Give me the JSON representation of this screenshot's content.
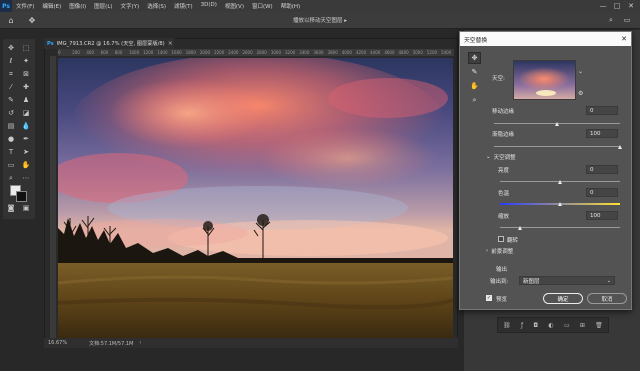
{
  "app": {
    "logo": "Ps"
  },
  "menu": {
    "items": [
      "文件(F)",
      "编辑(E)",
      "图像(I)",
      "图层(L)",
      "文字(Y)",
      "选择(S)",
      "滤镜(T)",
      "3D(D)",
      "视图(V)",
      "窗口(W)",
      "帮助(H)"
    ],
    "window_controls": [
      "—",
      "□",
      "✕"
    ]
  },
  "options_bar": {
    "center_title": "播放以移动天空图层 ▸"
  },
  "document": {
    "tab_title": "IMG_7913.CR2 @ 16.7% (天空, 图层蒙版/8)",
    "tab_close": "×",
    "ruler_ticks": [
      "0",
      "200",
      "400",
      "600",
      "800",
      "1000",
      "1200",
      "1400",
      "1600",
      "1800",
      "2000",
      "2200",
      "2400",
      "2600",
      "2800",
      "3000",
      "3200",
      "3400",
      "3600",
      "3800",
      "4000",
      "4200",
      "4400",
      "4600",
      "4800",
      "5000",
      "5200",
      "5400"
    ],
    "zoom": "16.67%",
    "doc_info": "文档:57.1M/57.1M",
    "status_arrow": "›"
  },
  "dialog": {
    "title": "天空替换",
    "close": "✕",
    "sky_label": "天空:",
    "shift_edge_label": "移动边缘",
    "shift_edge_value": "0",
    "fade_edge_label": "渐隐边缘",
    "fade_edge_value": "100",
    "sky_adjust_label": "天空调整",
    "brightness_label": "亮度",
    "brightness_value": "0",
    "temperature_label": "色温",
    "temperature_value": "0",
    "scale_label": "缩放",
    "scale_value": "100",
    "flip_label": "翻转",
    "foreground_label": "前景调整",
    "output_label": "输出",
    "output_to_label": "输出到:",
    "output_to_value": "新图层",
    "preview_label": "预览",
    "ok_label": "确定",
    "cancel_label": "取消",
    "sliders": {
      "shift_edge": 0.5,
      "fade_edge": 1.0,
      "brightness": 0.5,
      "temperature": 0.5,
      "scale": 0.17
    }
  },
  "colors": {
    "accent": "#31a8ff",
    "sky_top": "#3a4a7a",
    "sky_glow": "#f07a6a",
    "field": "#6a5420"
  }
}
